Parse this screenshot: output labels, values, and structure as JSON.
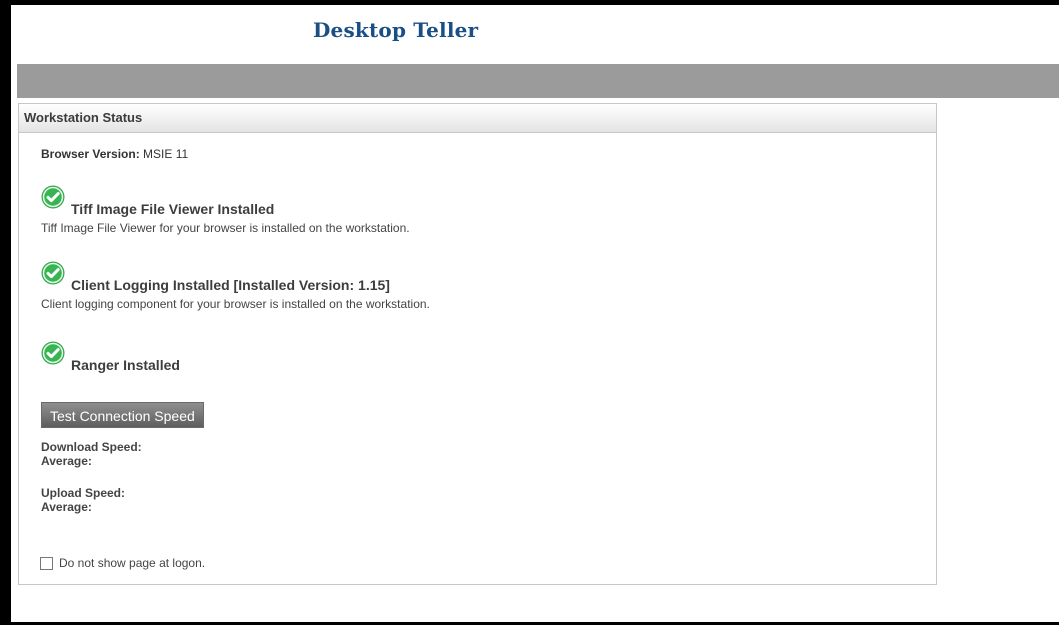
{
  "app": {
    "title": "Desktop Teller"
  },
  "panel": {
    "title": "Workstation Status",
    "browser_label": "Browser Version:",
    "browser_value": "MSIE 11"
  },
  "status_items": [
    {
      "title": "Tiff Image File Viewer Installed",
      "description": "Tiff Image File Viewer for your browser is installed on the workstation.",
      "icon": "check-icon"
    },
    {
      "title": "Client Logging Installed [Installed Version: 1.15]",
      "description": "Client logging component for your browser is installed on the workstation.",
      "icon": "check-icon"
    },
    {
      "title": "Ranger Installed",
      "description": "",
      "icon": "check-icon"
    }
  ],
  "speed": {
    "button_label": "Test Connection Speed",
    "download_label": "Download Speed:",
    "download_average": "Average:",
    "upload_label": "Upload Speed:",
    "upload_average": "Average:"
  },
  "logon": {
    "checkbox_label": "Do not show page at logon.",
    "checked": false
  },
  "colors": {
    "title": "#1a4f86",
    "nav_bar": "#9b9b9b",
    "check": "#2fa84a"
  }
}
